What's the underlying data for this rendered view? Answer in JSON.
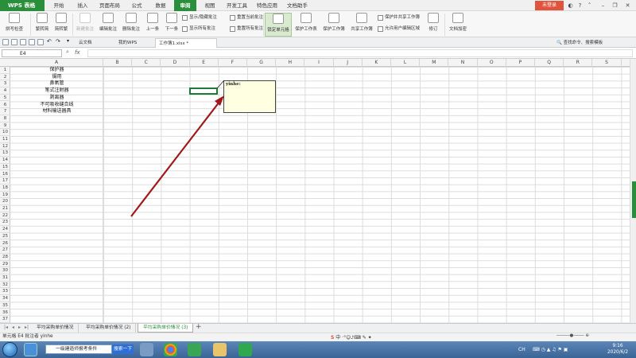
{
  "app": {
    "name": "WPS 表格",
    "login": "未登录"
  },
  "menu": {
    "tabs": [
      "开始",
      "插入",
      "页面布局",
      "公式",
      "数据",
      "审阅",
      "视图",
      "开发工具",
      "特色应用",
      "文档助手"
    ],
    "active": "审阅"
  },
  "ribbon": {
    "spell_check": "拼写检查",
    "trad_to_simp": "繁转简",
    "simp_to_trad": "简转繁",
    "new_comment": "新建批注",
    "edit_comment": "编辑批注",
    "delete_comment": "删除批注",
    "prev": "上一条",
    "next": "下一条",
    "show_hide_comment": "显示/隐藏批注",
    "reset_current_comment": "重置当前批注",
    "show_all_comments": "显示所有批注",
    "reset_all_comments": "重置所有批注",
    "lock_cell": "锁定单元格",
    "protect_sheet": "保护工作表",
    "protect_workbook": "保护工作簿",
    "share_workbook": "共享工作簿",
    "protect_share_workbook": "保护并共享工作簿",
    "allow_user_edit_ranges": "允许用户编辑区域",
    "revisions": "修订",
    "doc_encrypt": "文档加密"
  },
  "doc_tabs": [
    {
      "label": "云文档",
      "active": false
    },
    {
      "label": "我的WPS",
      "active": false
    },
    {
      "label": "工作簿1.xlsx *",
      "active": true
    }
  ],
  "search_placeholder": "查找命令、搜索模板",
  "formula_bar": {
    "cell_ref": "E4",
    "fx": "fx",
    "content": ""
  },
  "columns": [
    "A",
    "B",
    "C",
    "D",
    "E",
    "F",
    "G",
    "H",
    "I",
    "J",
    "K",
    "L",
    "M",
    "N",
    "O",
    "P",
    "Q",
    "R",
    "S"
  ],
  "rows": [
    "1",
    "2",
    "3",
    "4",
    "5",
    "6",
    "7",
    "8",
    "9",
    "10",
    "11",
    "12",
    "13",
    "14",
    "15",
    "16",
    "17",
    "18",
    "19",
    "20",
    "21",
    "22",
    "23",
    "24",
    "25",
    "26",
    "27",
    "28",
    "29",
    "30",
    "31",
    "32",
    "33",
    "34",
    "35",
    "36",
    "37"
  ],
  "cells_a": [
    "保护器",
    "镊用",
    "鼻氧管",
    "笔式注射器",
    "剥离器",
    "不可吸收缝合线",
    "材料输送器具"
  ],
  "selected_cell": "E4",
  "comment": {
    "author_label": "yinhe:",
    "text": ""
  },
  "sheets": [
    {
      "label": "平均采购单价情况",
      "active": false
    },
    {
      "label": "平均采购单价情况 (2)",
      "active": false
    },
    {
      "label": "平均采购单价情况 (3)",
      "active": true
    }
  ],
  "status": {
    "text": "单元格 E4 批注者 yinhe"
  },
  "ime": {
    "label": "中"
  },
  "taskbar": {
    "ie_address": "一级建造师报考条件",
    "search_button": "搜索一下",
    "time": "9:16",
    "date": "2020/6/2",
    "lang": "CH"
  },
  "colors": {
    "accent": "#2a8f3a",
    "arrow": "#a01818",
    "comment_bg": "#ffffe1"
  }
}
